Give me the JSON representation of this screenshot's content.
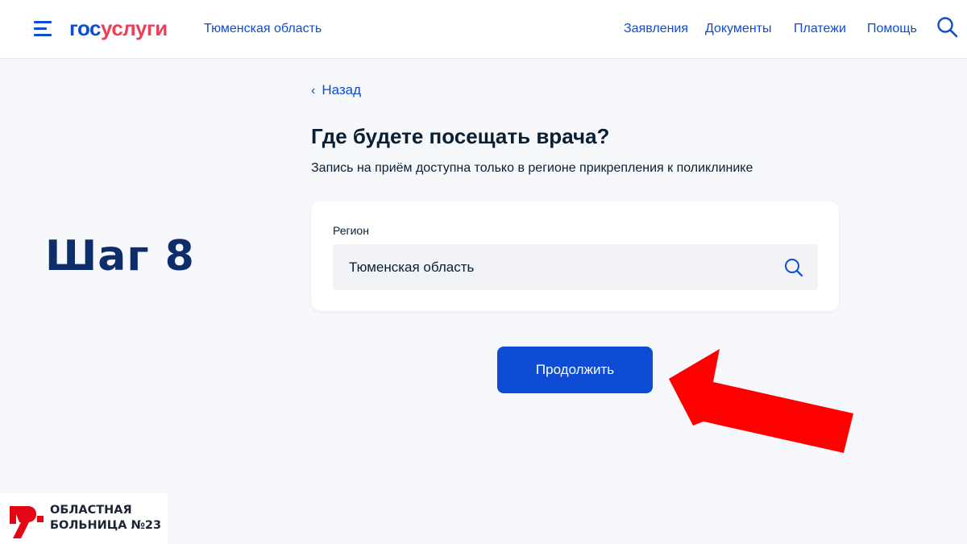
{
  "header": {
    "logo_part1": "гос",
    "logo_part2": "услуги",
    "region": "Тюменская область",
    "nav": [
      "Заявления",
      "Документы",
      "Платежи",
      "Помощь"
    ]
  },
  "page": {
    "back_label": "Назад",
    "title": "Где будете посещать врача?",
    "subtitle": "Запись на приём доступна только в регионе прикрепления к поликлинике",
    "region_field": {
      "label": "Регион",
      "value": "Тюменская область"
    },
    "continue_label": "Продолжить"
  },
  "overlay": {
    "step_label": "Шаг 8",
    "arrow_color": "#ff0000",
    "hospital_line1": "ОБЛАСТНАЯ",
    "hospital_line2": "БОЛЬНИЦА №23"
  },
  "colors": {
    "brand_blue": "#0d4cd3",
    "brand_red": "#ee3f58",
    "page_bg": "#f6f8fb",
    "step_color": "#0e2e6b"
  },
  "icons": [
    "menu-icon",
    "search-icon",
    "chevron-left-icon",
    "hospital-logo-icon"
  ]
}
